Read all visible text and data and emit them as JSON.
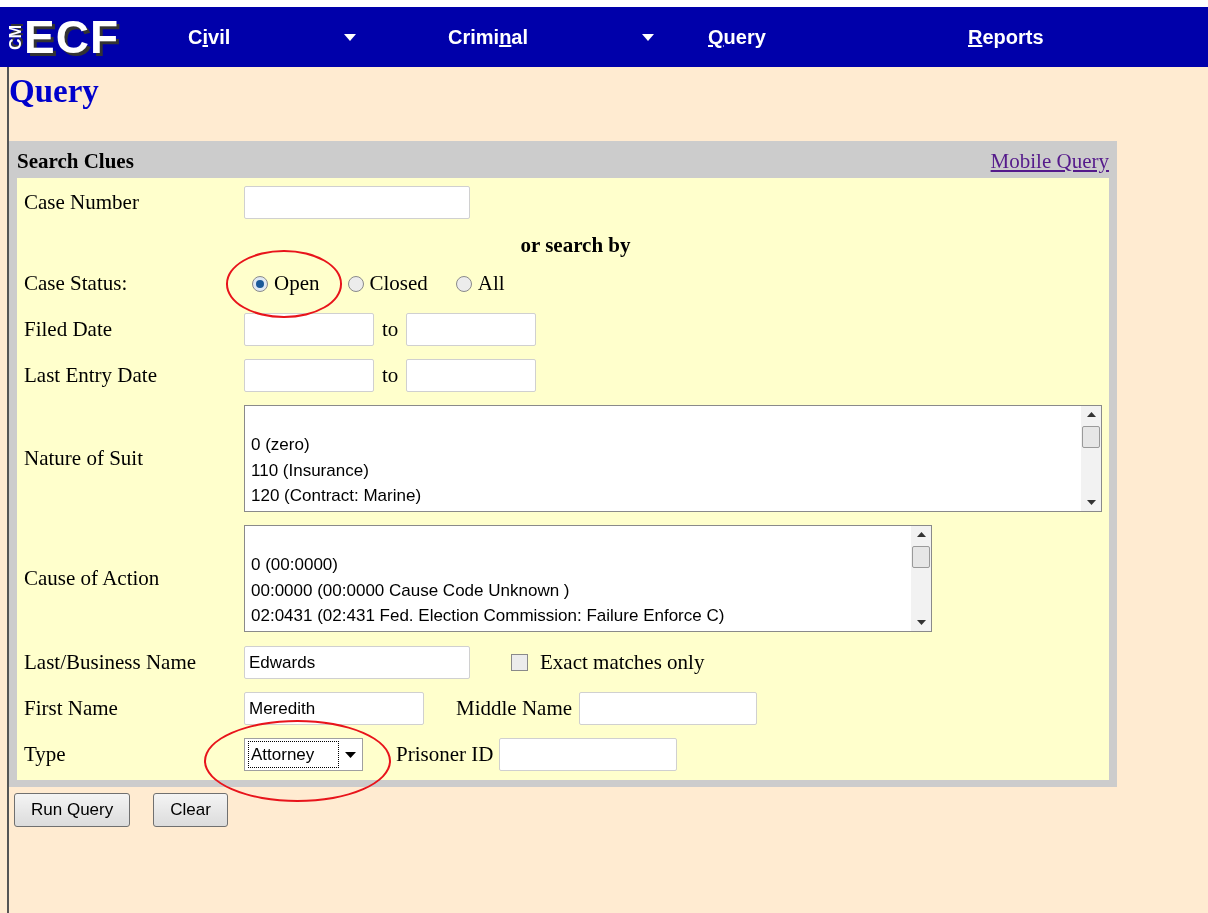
{
  "header": {
    "logo": {
      "side": "CM",
      "main": "ECF"
    },
    "menu": [
      {
        "label": {
          "before": "C",
          "key": "i",
          "after": "vil"
        },
        "dropdown": true
      },
      {
        "label": {
          "before": "Crimi",
          "key": "n",
          "after": "al"
        },
        "dropdown": true
      },
      {
        "label": {
          "key": "Q",
          "after": "uery"
        },
        "dropdown": false
      },
      {
        "label": {
          "key": "R",
          "after": "eports"
        },
        "dropdown": false
      }
    ]
  },
  "page_title": "Query",
  "search_panel": {
    "title": "Search Clues",
    "mobile_link": "Mobile Query",
    "rows": [
      {
        "kind": "text",
        "label": "Case Number"
      },
      {
        "kind": "heading",
        "text": "or search by"
      },
      {
        "kind": "radio",
        "label": "Case Status:",
        "options": [
          {
            "label": "Open",
            "selected": true,
            "highlighted": true
          },
          {
            "label": "Closed",
            "selected": false,
            "highlighted": false
          },
          {
            "label": "All",
            "selected": false,
            "highlighted": false
          }
        ]
      },
      {
        "kind": "date_range",
        "label": "Filed Date",
        "separator": "to"
      },
      {
        "kind": "date_range",
        "label": "Last Entry Date",
        "separator": "to"
      },
      {
        "kind": "listbox",
        "label": "Nature of Suit",
        "wide": true,
        "items": [
          "0 (zero)",
          "110 (Insurance)",
          "120 (Contract: Marine)"
        ]
      },
      {
        "kind": "listbox",
        "label": "Cause of Action",
        "wide": false,
        "items": [
          "0 (00:0000)",
          "00:0000 (00:0000 Cause Code Unknown )",
          "02:0431 (02:431 Fed. Election Commission: Failure Enforce C)"
        ]
      },
      {
        "kind": "name_check",
        "label": "Last/Business Name",
        "value": "Edwards",
        "checkbox": {
          "label": "Exact matches only",
          "checked": false
        }
      },
      {
        "kind": "name_pair",
        "label": "First Name",
        "value": "Meredith",
        "second_label": "Middle Name"
      },
      {
        "kind": "select_pair",
        "label": "Type",
        "value": "Attorney",
        "focused": true,
        "highlighted": true,
        "second_label": "Prisoner ID"
      }
    ]
  },
  "buttons": [
    "Run Query",
    "Clear"
  ]
}
